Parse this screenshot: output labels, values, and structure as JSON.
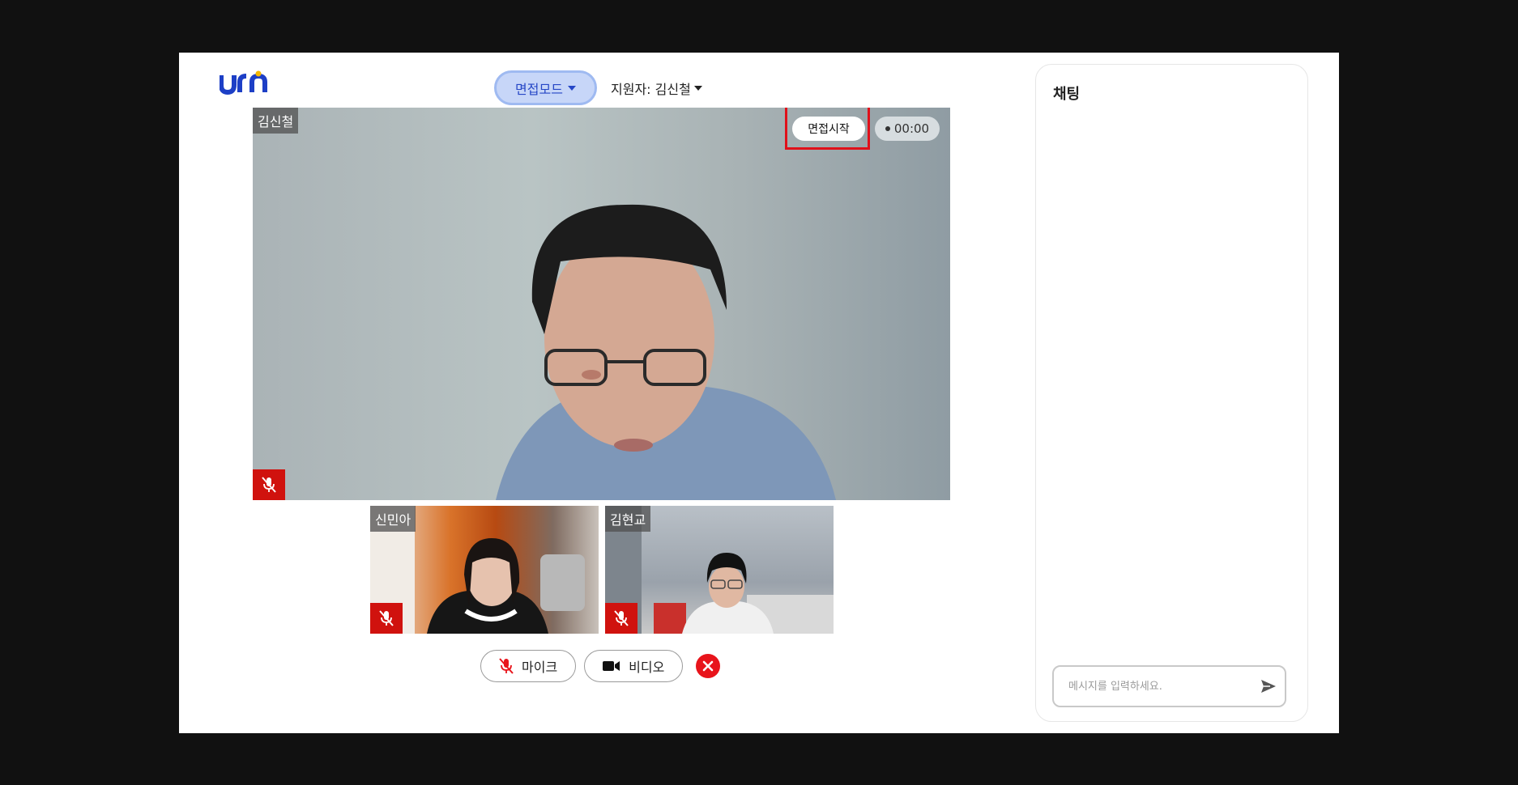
{
  "colors": {
    "page_bg": "#111111",
    "accent": "#2647c6",
    "mode_button_bg": "#c7d6f8",
    "mute_red": "#d0120e",
    "highlight_red": "#e0101a",
    "logo_blue": "#1d3fc6",
    "logo_yellow": "#f5b800"
  },
  "header": {
    "logo_text": "urn",
    "mode_label": "면접모드",
    "applicant_label": "지원자: 김신철"
  },
  "main_video": {
    "participant": "김신철",
    "start_button": "면접시작",
    "timer": "00:00",
    "mic_icon": "mic-muted-icon"
  },
  "participants": [
    {
      "name": "신민아",
      "mic_icon": "mic-muted-icon"
    },
    {
      "name": "김현교",
      "mic_icon": "mic-muted-icon"
    }
  ],
  "controls": {
    "mic_label": "마이크",
    "video_label": "비디오",
    "leave_icon": "close-icon"
  },
  "chat": {
    "title": "채팅",
    "input_value": "",
    "input_placeholder": "메시지를 입력하세요.",
    "send_icon": "send-icon"
  }
}
